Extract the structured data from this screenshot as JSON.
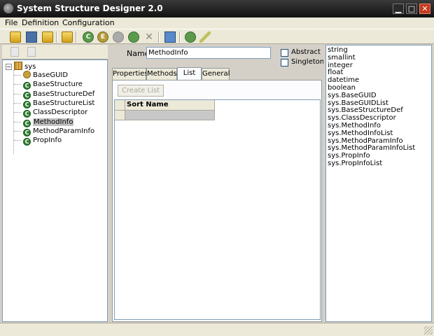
{
  "window": {
    "title": "System Structure Designer 2.0",
    "min_glyph": "▁",
    "max_glyph": "□",
    "close_glyph": "✕"
  },
  "menu": [
    "File",
    "Definition",
    "Configuration"
  ],
  "toolbar": {
    "icons": [
      "open-folder-icon",
      "save-icon",
      "package-icon",
      "open-project-icon",
      "class-icon",
      "enum-icon",
      "disabled-icon",
      "structure-icon",
      "delete-icon",
      "screen-icon",
      "export-icon",
      "edit-icon"
    ]
  },
  "tree": {
    "root": "sys",
    "expander": "−",
    "items": [
      {
        "label": "BaseGUID",
        "icon": "guid",
        "glyph": ""
      },
      {
        "label": "BaseStructure",
        "icon": "class",
        "glyph": "C"
      },
      {
        "label": "BaseStructureDef",
        "icon": "class",
        "glyph": "C"
      },
      {
        "label": "BaseStructureList",
        "icon": "class",
        "glyph": "C"
      },
      {
        "label": "ClassDescriptor",
        "icon": "class",
        "glyph": "C"
      },
      {
        "label": "MethodInfo",
        "icon": "class",
        "glyph": "C",
        "selected": true
      },
      {
        "label": "MethodParamInfo",
        "icon": "class",
        "glyph": "C"
      },
      {
        "label": "PropInfo",
        "icon": "class",
        "glyph": "C"
      }
    ]
  },
  "editor": {
    "name_label": "Name",
    "name_value": "MethodInfo",
    "abstract_label": "Abstract",
    "singleton_label": "Singleton",
    "abstract_checked": false,
    "singleton_checked": false,
    "tabs": [
      "Properties",
      "Methods",
      "List",
      "General"
    ],
    "active_tab": "List",
    "create_list_label": "Create List",
    "grid_header": "Sort Name"
  },
  "types": [
    "string",
    "smallint",
    "integer",
    "float",
    "datetime",
    "boolean",
    "sys.BaseGUID",
    "sys.BaseGUIDList",
    "sys.BaseStructureDef",
    "sys.ClassDescriptor",
    "sys.MethodInfo",
    "sys.MethodInfoList",
    "sys.MethodParamInfo",
    "sys.MethodParamInfoList",
    "sys.PropInfo",
    "sys.PropInfoList"
  ]
}
